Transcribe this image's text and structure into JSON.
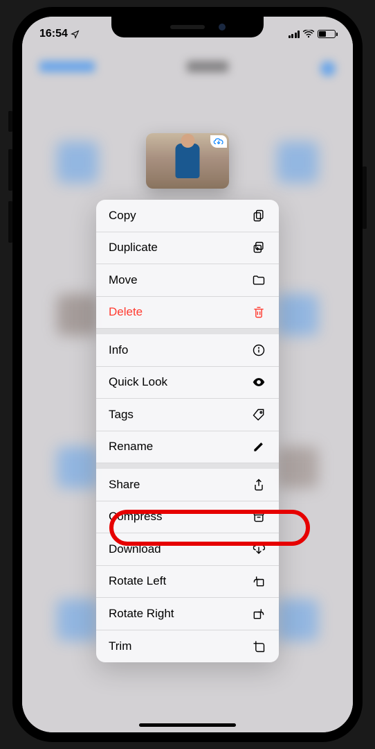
{
  "status_bar": {
    "time": "16:54"
  },
  "menu": {
    "groups": [
      [
        {
          "label": "Copy",
          "icon": "copy",
          "destructive": false
        },
        {
          "label": "Duplicate",
          "icon": "duplicate",
          "destructive": false
        },
        {
          "label": "Move",
          "icon": "folder",
          "destructive": false
        },
        {
          "label": "Delete",
          "icon": "trash",
          "destructive": true
        }
      ],
      [
        {
          "label": "Info",
          "icon": "info",
          "destructive": false
        },
        {
          "label": "Quick Look",
          "icon": "eye",
          "destructive": false
        },
        {
          "label": "Tags",
          "icon": "tag",
          "destructive": false
        },
        {
          "label": "Rename",
          "icon": "pencil",
          "destructive": false
        }
      ],
      [
        {
          "label": "Share",
          "icon": "share",
          "destructive": false
        },
        {
          "label": "Compress",
          "icon": "archive",
          "destructive": false
        },
        {
          "label": "Download",
          "icon": "download",
          "destructive": false
        },
        {
          "label": "Rotate Left",
          "icon": "rotate-left",
          "destructive": false
        },
        {
          "label": "Rotate Right",
          "icon": "rotate-right",
          "destructive": false
        },
        {
          "label": "Trim",
          "icon": "trim",
          "destructive": false
        }
      ]
    ]
  },
  "annotation": {
    "highlighted_item": "Compress"
  }
}
